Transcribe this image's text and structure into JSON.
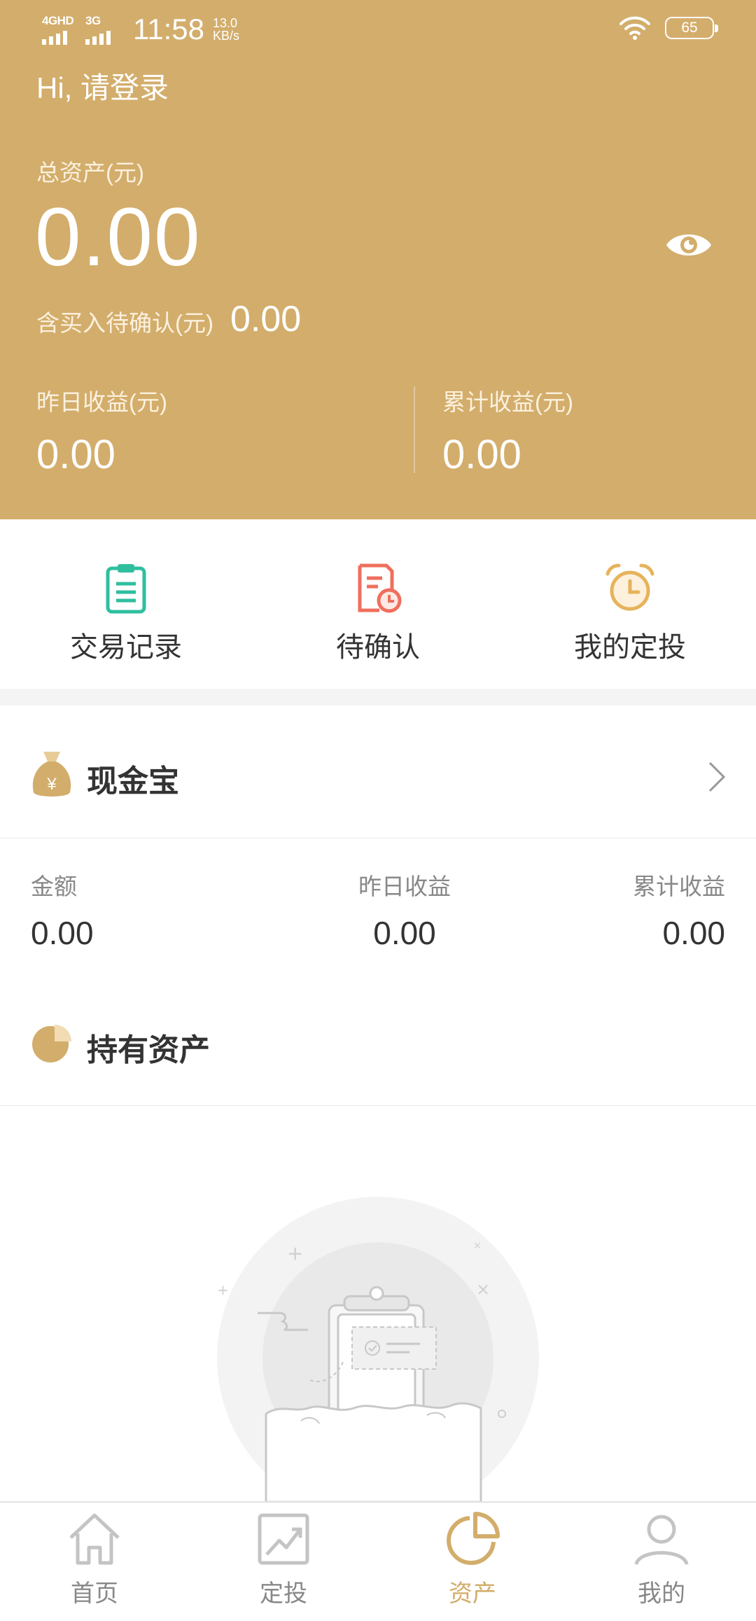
{
  "status_bar": {
    "net1": "4GHD",
    "net2": "3G",
    "time": "11:58",
    "speed_value": "13.0",
    "speed_unit": "KB/s",
    "battery": "65"
  },
  "header": {
    "greeting": "Hi, 请登录",
    "total_label": "总资产(元)",
    "total_value": "0.00",
    "pending_label": "含买入待确认(元)",
    "pending_value": "0.00",
    "yesterday_label": "昨日收益(元)",
    "yesterday_value": "0.00",
    "cumulative_label": "累计收益(元)",
    "cumulative_value": "0.00",
    "accent": "#d3ad6b"
  },
  "actions": [
    {
      "label": "交易记录",
      "icon": "clipboard-icon",
      "color": "#2fbf9f"
    },
    {
      "label": "待确认",
      "icon": "pending-doc-icon",
      "color": "#ef6f5e"
    },
    {
      "label": "我的定投",
      "icon": "alarm-clock-icon",
      "color": "#e6b35c"
    }
  ],
  "cash": {
    "title": "现金宝",
    "amount_label": "金额",
    "amount_value": "0.00",
    "yesterday_label": "昨日收益",
    "yesterday_value": "0.00",
    "cumulative_label": "累计收益",
    "cumulative_value": "0.00"
  },
  "holdings": {
    "title": "持有资产"
  },
  "nav": [
    {
      "label": "首页",
      "icon": "home-icon",
      "active": false
    },
    {
      "label": "定投",
      "icon": "trend-chart-icon",
      "active": false
    },
    {
      "label": "资产",
      "icon": "pie-chart-icon",
      "active": true
    },
    {
      "label": "我的",
      "icon": "user-icon",
      "active": false
    }
  ]
}
